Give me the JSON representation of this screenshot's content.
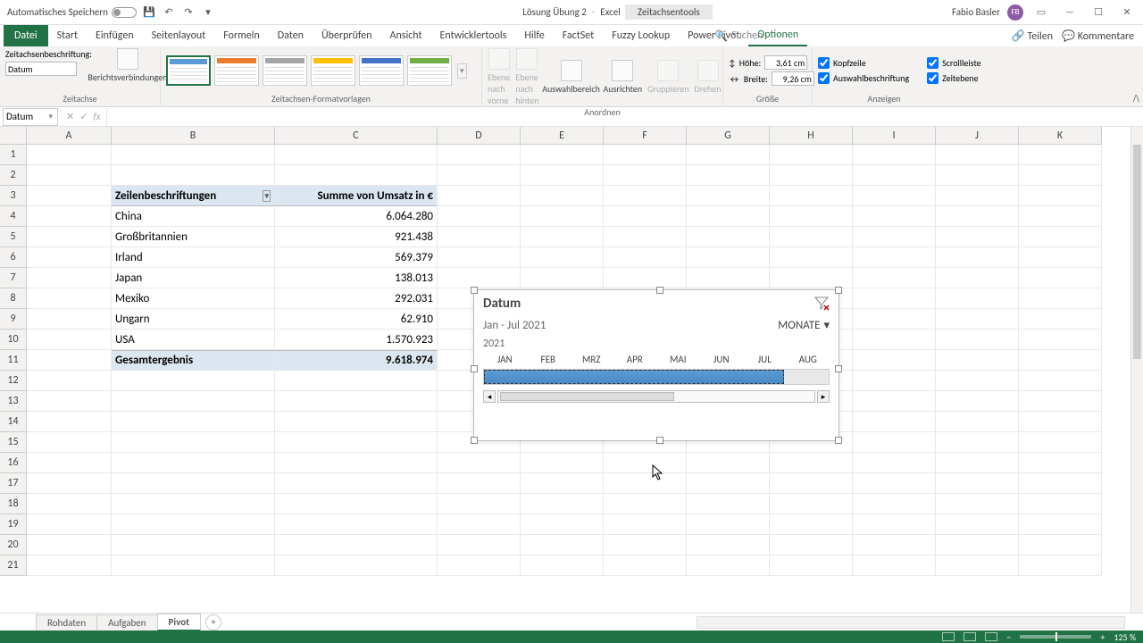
{
  "app": {
    "autosave": "Automatisches Speichern",
    "doc_title": "Lösung Übung 2",
    "app_name": "Excel",
    "contextual_tab": "Zeitachsentools",
    "user": "Fabio Basler",
    "user_initials": "FB"
  },
  "ribbon_tabs": {
    "file": "Datei",
    "t1": "Start",
    "t2": "Einfügen",
    "t3": "Seitenlayout",
    "t4": "Formeln",
    "t5": "Daten",
    "t6": "Überprüfen",
    "t7": "Ansicht",
    "t8": "Entwicklertools",
    "t9": "Hilfe",
    "t10": "FactSet",
    "t11": "Fuzzy Lookup",
    "t12": "Power Pivot",
    "t13": "Optionen",
    "search": "Suchen",
    "share": "Teilen",
    "comments": "Kommentare"
  },
  "ribbon": {
    "caption_label": "Zeitachsenbeschriftung:",
    "caption_value": "Datum",
    "reportconn": "Berichtsverbindungen",
    "g1": "Zeitachse",
    "g2": "Zeitachsen-Formatvorlagen",
    "g3": "Anordnen",
    "g4": "Größe",
    "g5": "Anzeigen",
    "front": "Ebene nach vorne",
    "back": "Ebene nach hinten",
    "selpane": "Auswahlbereich",
    "align": "Ausrichten",
    "group": "Gruppieren",
    "rotate": "Drehen",
    "height_label": "Höhe:",
    "height_val": "3,61 cm",
    "width_label": "Breite:",
    "width_val": "9,26 cm",
    "chk_header": "Kopfzeile",
    "chk_scroll": "Scrollleiste",
    "chk_sellabel": "Auswahlbeschriftung",
    "chk_timelevel": "Zeitebene"
  },
  "namebox": "Datum",
  "cols": {
    "A": "A",
    "B": "B",
    "C": "C",
    "D": "D",
    "E": "E",
    "F": "F",
    "G": "G",
    "H": "H",
    "I": "I",
    "J": "J",
    "K": "K"
  },
  "pivot": {
    "hdr1": "Zeilenbeschriftungen",
    "hdr2": "Summe von Umsatz in €",
    "r1c": "China",
    "r1v": "6.064.280",
    "r2c": "Großbritannien",
    "r2v": "921.438",
    "r3c": "Irland",
    "r3v": "569.379",
    "r4c": "Japan",
    "r4v": "138.013",
    "r5c": "Mexiko",
    "r5v": "292.031",
    "r6c": "Ungarn",
    "r6v": "62.910",
    "r7c": "USA",
    "r7v": "1.570.923",
    "total_l": "Gesamtergebnis",
    "total_v": "9.618.974"
  },
  "timeline": {
    "title": "Datum",
    "range": "Jan - Jul 2021",
    "level": "MONATE",
    "year": "2021",
    "m1": "JAN",
    "m2": "FEB",
    "m3": "MRZ",
    "m4": "APR",
    "m5": "MAI",
    "m6": "JUN",
    "m7": "JUL",
    "m8": "AUG"
  },
  "sheets": {
    "s1": "Rohdaten",
    "s2": "Aufgaben",
    "s3": "Pivot"
  },
  "status": {
    "zoom": "125 %"
  }
}
